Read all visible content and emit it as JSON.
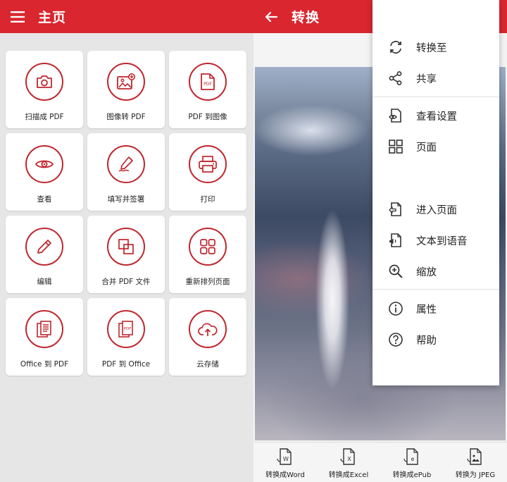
{
  "left_panel": {
    "title": "主页",
    "tiles": [
      {
        "label": "扫描成 PDF",
        "icon": "camera-icon"
      },
      {
        "label": "图像转 PDF",
        "icon": "image-add-icon"
      },
      {
        "label": "PDF 到图像",
        "icon": "pdf-file-icon"
      },
      {
        "label": "查看",
        "icon": "eye-icon"
      },
      {
        "label": "填写并签署",
        "icon": "pen-sign-icon"
      },
      {
        "label": "打印",
        "icon": "printer-icon"
      },
      {
        "label": "编辑",
        "icon": "pencil-icon"
      },
      {
        "label": "合并 PDF 文件",
        "icon": "merge-icon"
      },
      {
        "label": "重新排列页面",
        "icon": "grid-pages-icon"
      },
      {
        "label": "Office 到 PDF",
        "icon": "document-lines-icon"
      },
      {
        "label": "PDF 到 Office",
        "icon": "pdf-stack-icon"
      },
      {
        "label": "云存储",
        "icon": "cloud-upload-icon"
      }
    ]
  },
  "right_panel": {
    "title": "转换",
    "bottom_bar": [
      {
        "label": "转换成Word",
        "icon": "convert-word-icon",
        "letter": "W"
      },
      {
        "label": "转换成Excel",
        "icon": "convert-excel-icon",
        "letter": "X"
      },
      {
        "label": "转换成ePub",
        "icon": "convert-epub-icon",
        "letter": "e"
      },
      {
        "label": "转换为 JPEG",
        "icon": "convert-jpeg-icon",
        "letter": ""
      }
    ]
  },
  "overflow_menu": {
    "items": [
      {
        "label": "转换至",
        "icon": "sync-icon"
      },
      {
        "label": "共享",
        "icon": "share-icon"
      },
      {
        "label": "查看设置",
        "icon": "view-settings-icon"
      },
      {
        "label": "页面",
        "icon": "pages-grid-icon"
      },
      {
        "label": "进入页面",
        "icon": "goto-page-icon"
      },
      {
        "label": "文本到语音",
        "icon": "text-to-speech-icon"
      },
      {
        "label": "缩放",
        "icon": "zoom-in-icon"
      },
      {
        "label": "属性",
        "icon": "info-icon"
      },
      {
        "label": "帮助",
        "icon": "help-icon"
      }
    ]
  },
  "colors": {
    "brand_red": "#d9262f",
    "icon_red": "#c0262e",
    "background": "#e6e6e6"
  }
}
